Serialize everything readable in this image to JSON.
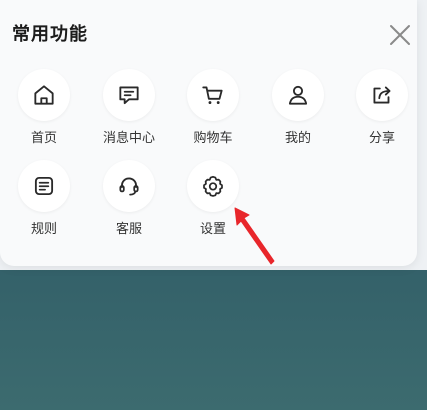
{
  "panel": {
    "title": "常用功能",
    "close_icon": "close-icon"
  },
  "items": [
    {
      "label": "首页",
      "icon": "home-icon"
    },
    {
      "label": "消息中心",
      "icon": "message-icon"
    },
    {
      "label": "购物车",
      "icon": "cart-icon"
    },
    {
      "label": "我的",
      "icon": "user-icon"
    },
    {
      "label": "分享",
      "icon": "share-icon"
    },
    {
      "label": "规则",
      "icon": "rules-icon"
    },
    {
      "label": "客服",
      "icon": "headset-icon"
    },
    {
      "label": "设置",
      "icon": "gear-icon"
    }
  ],
  "colors": {
    "accent_arrow": "#e8262b",
    "icon_stroke": "#2a2a2a",
    "background_dark": "#2f5b66"
  }
}
